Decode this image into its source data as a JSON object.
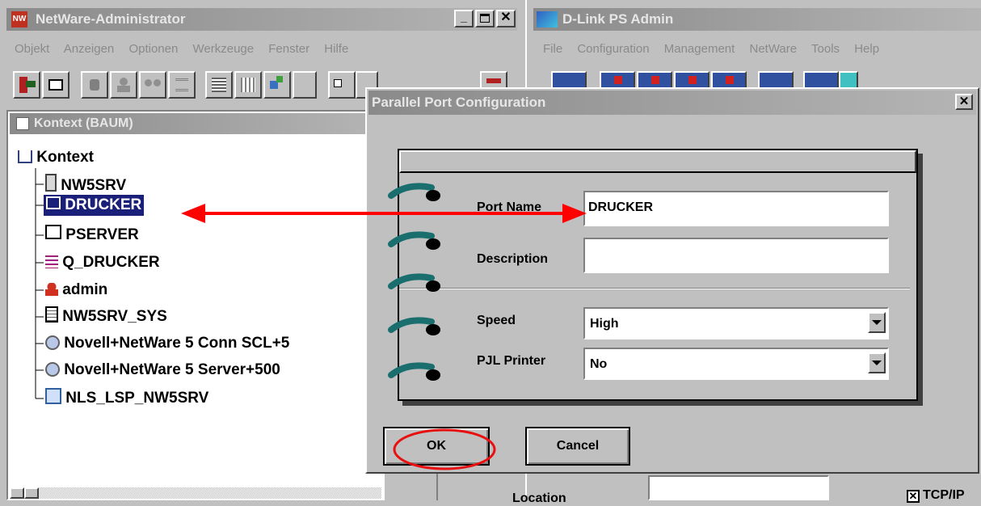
{
  "netware": {
    "title": "NetWare-Administrator",
    "menu": [
      "Objekt",
      "Anzeigen",
      "Optionen",
      "Werkzeuge",
      "Fenster",
      "Hilfe"
    ],
    "context_title": "Kontext (BAUM)",
    "tree_root": "Kontext",
    "tree_items": [
      {
        "label": "NW5SRV",
        "icon": "server-icon"
      },
      {
        "label": "DRUCKER",
        "icon": "printer-icon"
      },
      {
        "label": "PSERVER",
        "icon": "print-server-icon"
      },
      {
        "label": "Q_DRUCKER",
        "icon": "print-queue-icon"
      },
      {
        "label": "admin",
        "icon": "user-icon"
      },
      {
        "label": "NW5SRV_SYS",
        "icon": "volume-icon"
      },
      {
        "label": "Novell+NetWare 5 Conn SCL+5",
        "icon": "license-icon"
      },
      {
        "label": "Novell+NetWare 5 Server+500",
        "icon": "license-icon"
      },
      {
        "label": "NLS_LSP_NW5SRV",
        "icon": "license-server-icon"
      }
    ]
  },
  "dlink": {
    "title": "D-Link PS Admin",
    "menu": [
      "File",
      "Configuration",
      "Management",
      "NetWare",
      "Tools",
      "Help"
    ]
  },
  "dialog": {
    "title": "Parallel Port Configuration",
    "port_name_label": "Port Name",
    "port_name_value": "DRUCKER",
    "description_label": "Description",
    "description_value": "",
    "speed_label": "Speed",
    "speed_value": "High",
    "pjl_label": "PJL Printer",
    "pjl_value": "No",
    "ok_label": "OK",
    "cancel_label": "Cancel"
  },
  "background": {
    "location_label": "Location",
    "tcpip_label": "TCP/IP"
  },
  "annotation": {
    "arrow_color": "#ff0000",
    "ok_circle_color": "#e81010"
  }
}
